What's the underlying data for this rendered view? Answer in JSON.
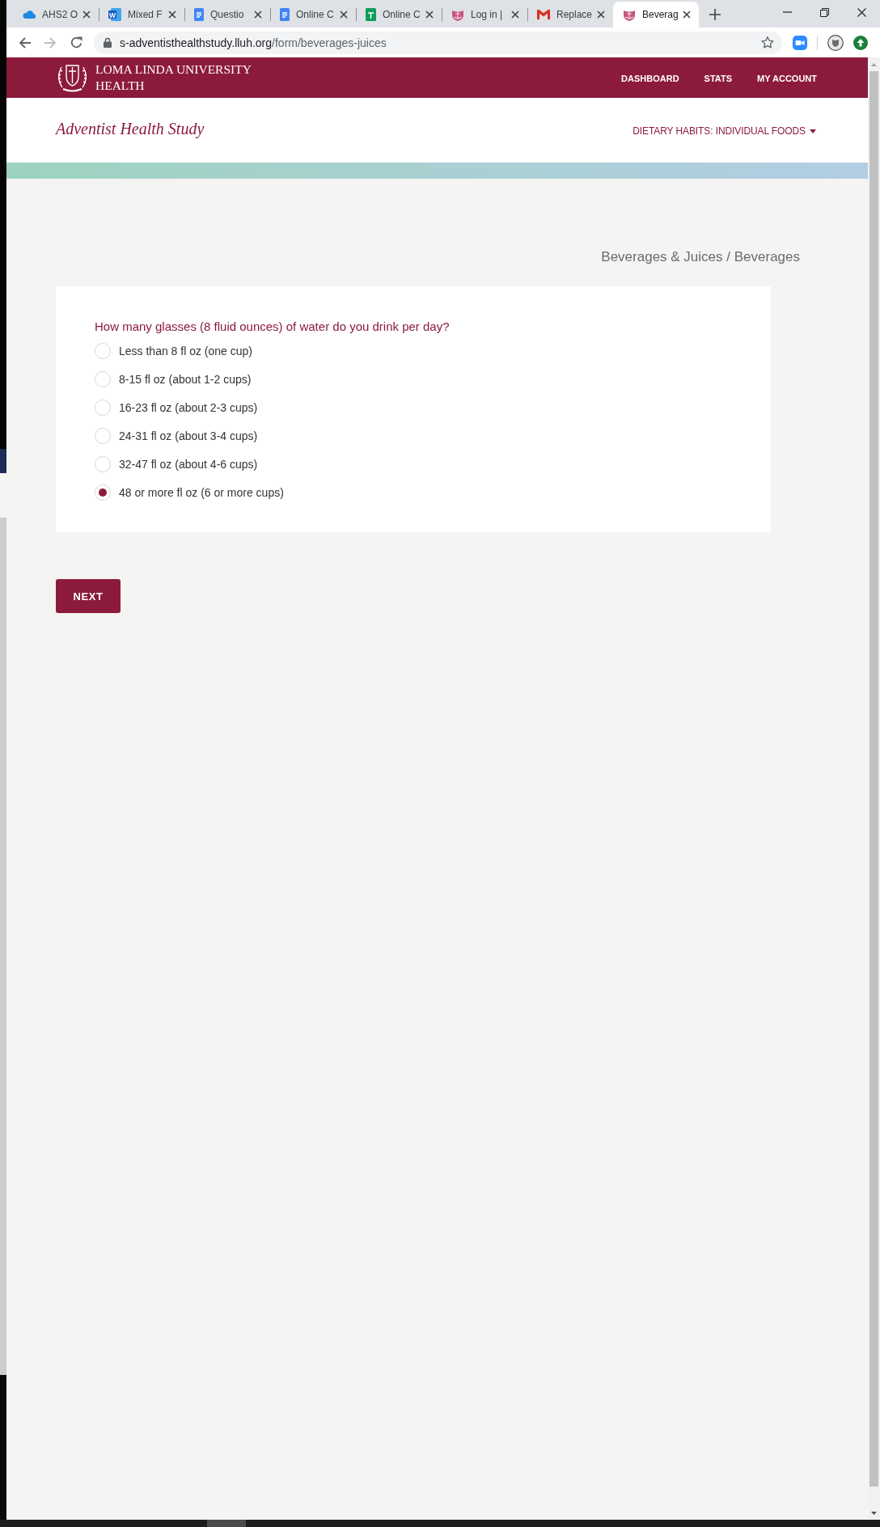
{
  "browser": {
    "tabs": [
      {
        "title": "AHS2 O",
        "selected": false
      },
      {
        "title": "Mixed F",
        "icon_text": "W",
        "selected": false
      },
      {
        "title": "Questio",
        "selected": false
      },
      {
        "title": "Online C",
        "selected": false
      },
      {
        "title": "Online C",
        "selected": false
      },
      {
        "title": "Log in |",
        "selected": false
      },
      {
        "title": "Replace",
        "selected": false
      },
      {
        "title": "Beverag",
        "selected": true
      }
    ],
    "forward_disabled": true,
    "address_bar": {
      "host": "s-adventisthealthstudy.lluh.org",
      "path": "/form/beverages-juices"
    }
  },
  "header": {
    "org_name": [
      "LOMA LINDA UNIVERSITY",
      "HEALTH"
    ],
    "nav": [
      "DASHBOARD",
      "STATS",
      "MY ACCOUNT"
    ]
  },
  "subheader": {
    "site_title": "Adventist Health Study",
    "section_menu": "DIETARY HABITS: INDIVIDUAL FOODS"
  },
  "breadcrumb": "Beverages & Juices / Beverages",
  "question": {
    "text": "How many glasses (8 fluid ounces) of water do you drink per day?",
    "options": [
      {
        "label": "Less than 8 fl oz (one cup)",
        "selected": false
      },
      {
        "label": "8-15 fl oz (about 1-2 cups)",
        "selected": false
      },
      {
        "label": "16-23 fl oz (about 2-3 cups)",
        "selected": false
      },
      {
        "label": "24-31 fl oz (about 3-4 cups)",
        "selected": false
      },
      {
        "label": "32-47 fl oz (about 4-6 cups)",
        "selected": false
      },
      {
        "label": "48 or more fl oz (6 or more cups)",
        "selected": true
      }
    ]
  },
  "next_button": "NEXT"
}
